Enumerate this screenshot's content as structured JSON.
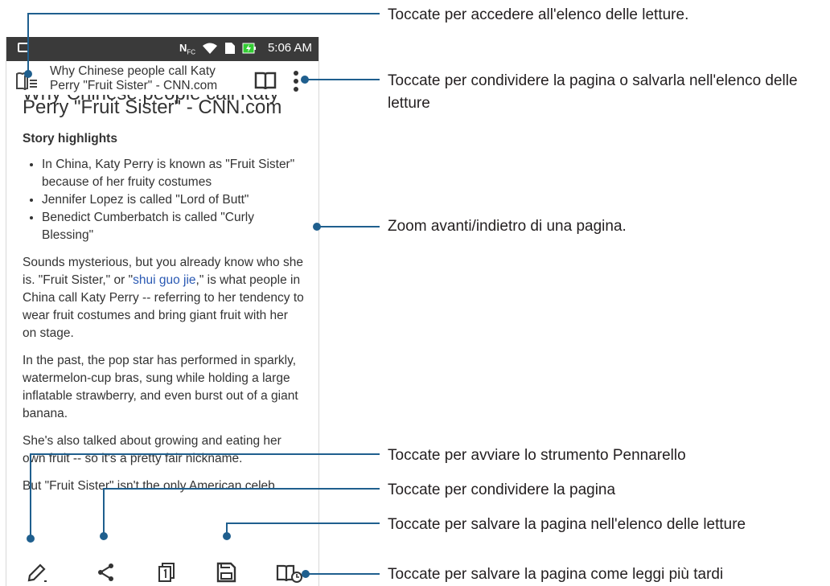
{
  "status_bar": {
    "time": "5:06 AM",
    "nfc": "N",
    "nfc_sub": "FC"
  },
  "top_bar": {
    "title": "Why Chinese people call Katy Perry \"Fruit Sister\" - CNN.com"
  },
  "article": {
    "headline": "Why Chinese people call Katy Perry \"Fruit Sister\" - CNN.com",
    "ghost_line": "Why Chinese people call Katy",
    "headline_visible": "Perry \"Fruit Sister\" - CNN.com",
    "highlights_title": "Story highlights",
    "bullets": [
      "In China, Katy Perry is known as \"Fruit Sister\" because of her fruity costumes",
      "Jennifer Lopez is called \"Lord of Butt\"",
      "Benedict Cumberbatch is called \"Curly Blessing\""
    ],
    "p1_before": "Sounds mysterious, but you already know who she is. \"Fruit Sister,\" or \"",
    "p1_link": "shui guo jie",
    "p1_after": ",\" is what people in China call Katy Perry -- referring to her tendency to wear fruit costumes and bring giant fruit with her on stage.",
    "p2": "In the past, the pop star has performed in sparkly, watermelon-cup bras, sung while holding a large inflatable strawberry, and even burst out of a giant banana.",
    "p3": "She's also talked about growing and eating her own fruit -- so it's a pretty fair nickname.",
    "p4": "But \"Fruit Sister\" isn't the only American celeb"
  },
  "callouts": {
    "reading_list": "Toccate per accedere all'elenco delle letture.",
    "share_or_save": "Toccate per condividere la pagina o salvarla nell'elenco delle letture",
    "zoom": "Zoom avanti/indietro di una pagina.",
    "marker": "Toccate per avviare lo strumento Pennarello",
    "share": "Toccate per condividere la pagina",
    "save_reading_list": "Toccate per salvare la pagina nell'elenco delle letture",
    "read_later": "Toccate per salvare la pagina come leggi più tardi"
  },
  "colors": {
    "status_bar": "#3a3a3a",
    "link": "#2a59b3",
    "callout_line": "#1f5f8e"
  }
}
